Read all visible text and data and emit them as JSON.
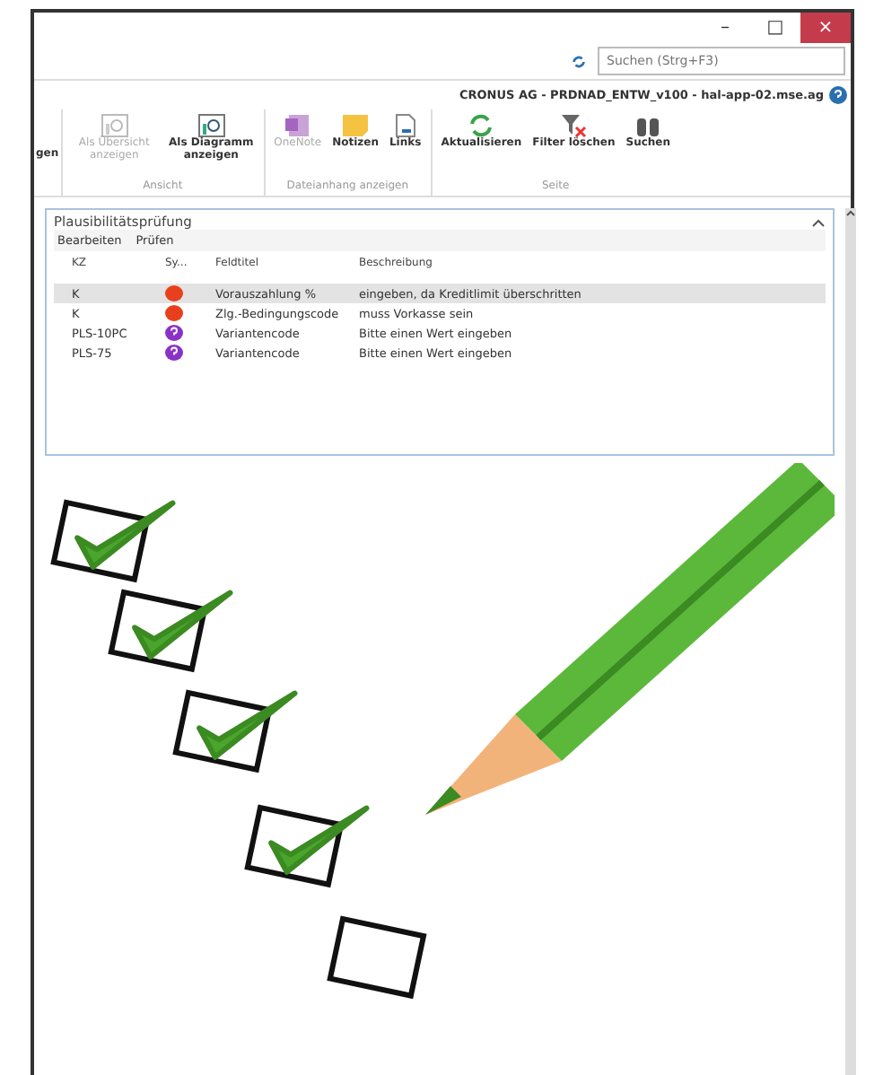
{
  "window": {
    "controls": [
      "–",
      "□",
      "×"
    ]
  },
  "search": {
    "placeholder": "Suchen (Strg+F3)"
  },
  "company": "CRONUS AG - PRDNAD_ENTW_v100 - hal-app-02.mse.ag",
  "ribbon": {
    "cut_button": "gen",
    "groups": [
      {
        "label": "Ansicht",
        "buttons": [
          {
            "label": "Als Übersicht anzeigen",
            "disabled": true
          },
          {
            "label": "Als Diagramm anzeigen",
            "disabled": false
          }
        ]
      },
      {
        "label": "Dateianhang anzeigen",
        "buttons": [
          {
            "label": "OneNote",
            "disabled": true
          },
          {
            "label": "Notizen",
            "disabled": false
          },
          {
            "label": "Links",
            "disabled": false
          }
        ]
      },
      {
        "label": "Seite",
        "buttons": [
          {
            "label": "Aktualisieren",
            "disabled": false
          },
          {
            "label": "Filter löschen",
            "disabled": false
          },
          {
            "label": "Suchen",
            "disabled": false
          }
        ]
      }
    ]
  },
  "panel": {
    "title": "Plausibilitätsprüfung",
    "menu": [
      "Bearbeiten",
      "Prüfen"
    ],
    "columns": [
      "KZ",
      "Sy...",
      "Feldtitel",
      "Beschreibung"
    ],
    "rows": [
      {
        "kz": "K",
        "kind": "error",
        "field": "Vorauszahlung %",
        "description": "eingeben, da Kreditlimit überschritten",
        "selected": true
      },
      {
        "kz": "K",
        "kind": "error",
        "field": "Zlg.-Bedingungscode",
        "description": "muss Vorkasse sein",
        "selected": false
      },
      {
        "kz": "PLS-10PC",
        "kind": "question",
        "field": "Variantencode",
        "description": "Bitte einen Wert eingeben",
        "selected": false
      },
      {
        "kz": "PLS-75",
        "kind": "question",
        "field": "Variantencode",
        "description": "Bitte einen Wert eingeben",
        "selected": false
      }
    ]
  }
}
